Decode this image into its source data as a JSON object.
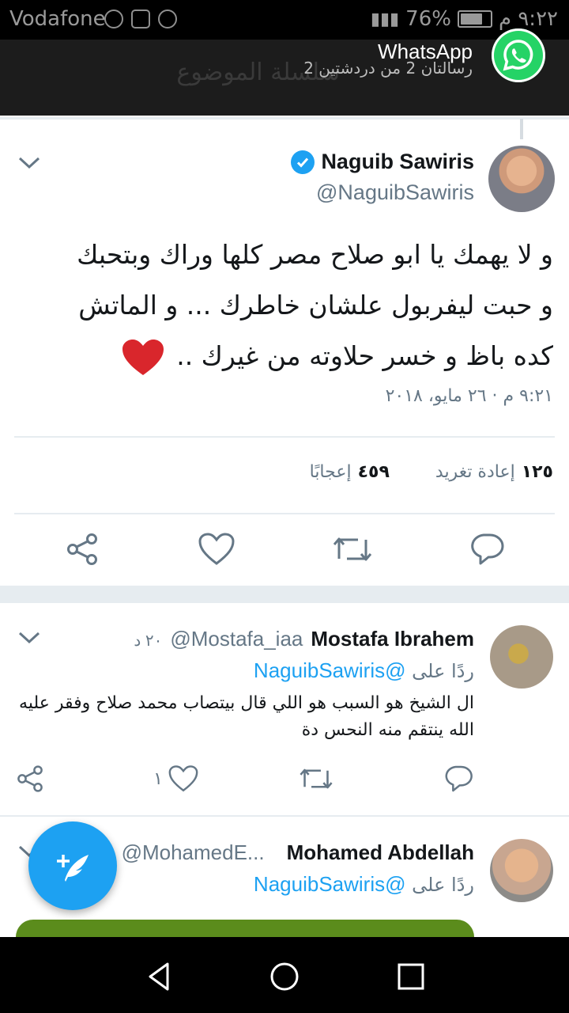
{
  "status_bar": {
    "carrier": "Vodafone",
    "battery": "76%",
    "battery_level": 0.76,
    "time": "٩:٢٢ م"
  },
  "notification": {
    "app_name": "WhatsApp",
    "message": "رسالتان 2 من دردشتين 2",
    "background_text": "سلسلة الموضوع"
  },
  "tweet": {
    "author_name": "Naguib Sawiris",
    "author_handle": "@NaguibSawiris",
    "verified": true,
    "text_lines": [
      "و لا يهمك يا ابو صلاح مصر كلها وراك وبتحبك",
      "و حبت ليفربول علشان خاطرك ... و الماتش",
      "كده باظ و خسر حلاوته من غيرك .."
    ],
    "emoji": "heart",
    "timestamp": "٩:٢١ م · ٢٦ مايو، ٢٠١٨",
    "retweets_count": "١٢٥",
    "retweets_label": "إعادة تغريد",
    "likes_count": "٤٥٩",
    "likes_label": "إعجابًا"
  },
  "replies": [
    {
      "name": "Mostafa Ibrahem",
      "handle": "@Mostafa_iaa",
      "time": "٢٠ د",
      "reply_to_label": "ردًا على",
      "reply_to_handle": "@NaguibSawiris",
      "text": "ال الشيخ هو السبب هو اللي قال بيتصاب محمد صلاح وفقر عليه الله ينتقم منه النحس دة",
      "likes": "١"
    },
    {
      "name": "Mohamed Abdellah",
      "handle": "@MohamedE...",
      "reply_to_label": "ردًا على",
      "reply_to_handle": "@NaguibSawiris"
    }
  ],
  "icons": {
    "verified": "verified-badge-icon",
    "chevron": "chevron-down-icon",
    "share": "share-icon",
    "like": "heart-icon",
    "retweet": "retweet-icon",
    "reply": "reply-icon",
    "compose": "compose-tweet-icon"
  },
  "colors": {
    "accent": "#1da1f2",
    "heart_emoji": "#d9262c",
    "whatsapp": "#25d366"
  }
}
